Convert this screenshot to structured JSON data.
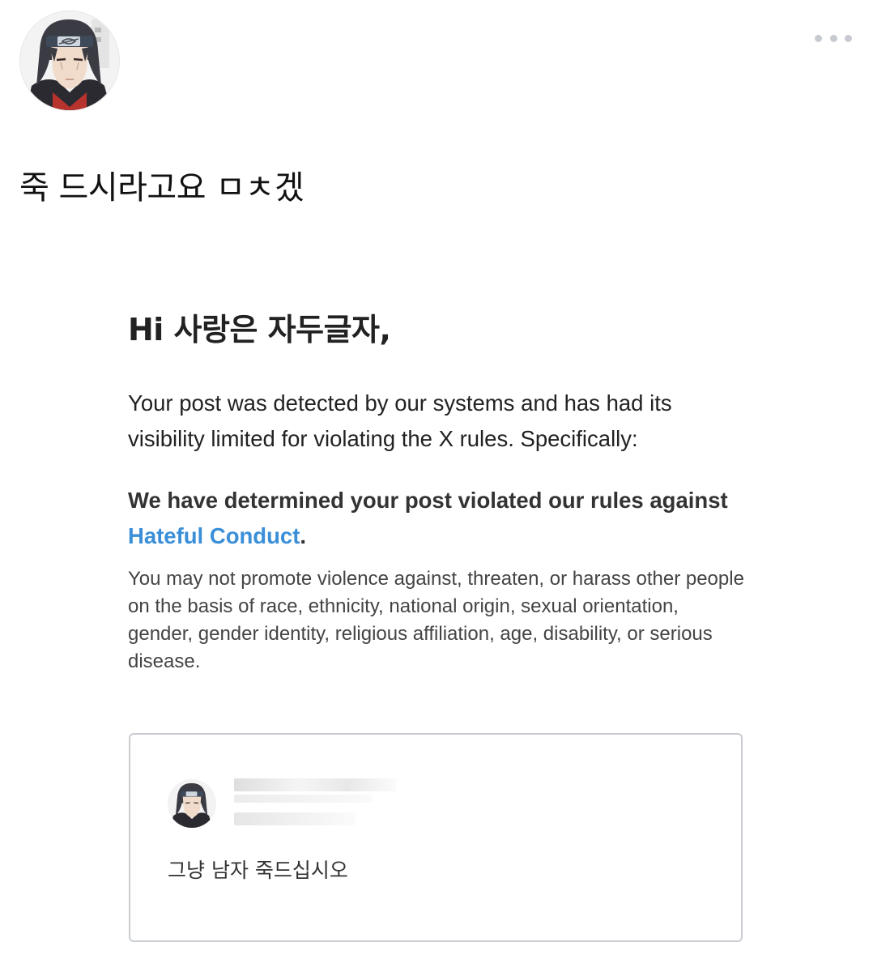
{
  "tweet": {
    "avatar_icon": "itachi-avatar-icon",
    "more_icon": "more-options-icon",
    "text": "죽 드시라고요 ㅁㅊ겠"
  },
  "notice": {
    "greeting": "Hi 사랑은 자두글자,",
    "body": "Your post was detected by our systems and has had its visibility limited for violating the X rules. Specifically:",
    "verdict_prefix": "We have determined your post violated our rules against ",
    "verdict_link": "Hateful Conduct",
    "verdict_suffix": ".",
    "policy": "You may not promote violence against, threaten, or harass other people on the basis of race, ethnicity, national origin, sexual orientation, gender, gender identity, religious affiliation, age, disability, or serious disease.",
    "link_color": "#3a8fd8"
  },
  "quoted_post": {
    "avatar_icon": "itachi-avatar-icon",
    "text": "그냥 남자 죽드십시오"
  }
}
